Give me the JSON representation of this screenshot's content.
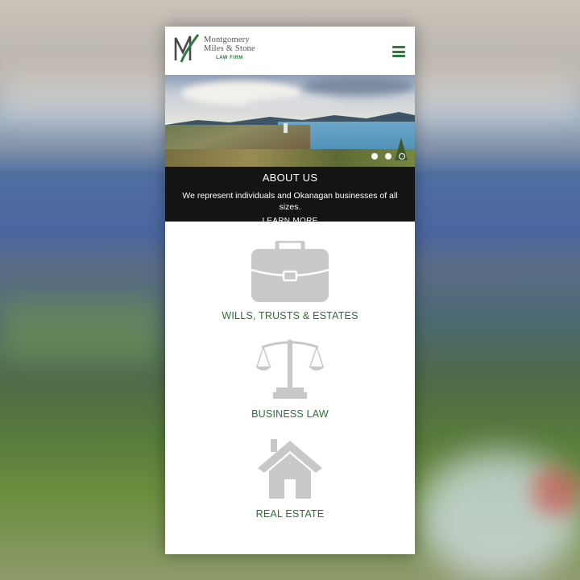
{
  "header": {
    "logo_line1": "Montgomery",
    "logo_line2": "Miles & Stone",
    "logo_sub": "LAW FIRM",
    "menu_icon": "hamburger-menu-icon"
  },
  "hero": {
    "slide_count": 3,
    "active_slide": 3
  },
  "about": {
    "title": "ABOUT US",
    "text": "We represent individuals and Okanagan businesses of all sizes.",
    "link": "LEARN MORE"
  },
  "services": [
    {
      "label": "WILLS, TRUSTS & ESTATES",
      "icon": "briefcase-icon"
    },
    {
      "label": "BUSINESS LAW",
      "icon": "scales-icon"
    },
    {
      "label": "REAL ESTATE",
      "icon": "house-icon"
    }
  ],
  "colors": {
    "accent": "#2e7a3a",
    "about_bg": "#141414",
    "icon_gray": "#c8c8c8"
  }
}
